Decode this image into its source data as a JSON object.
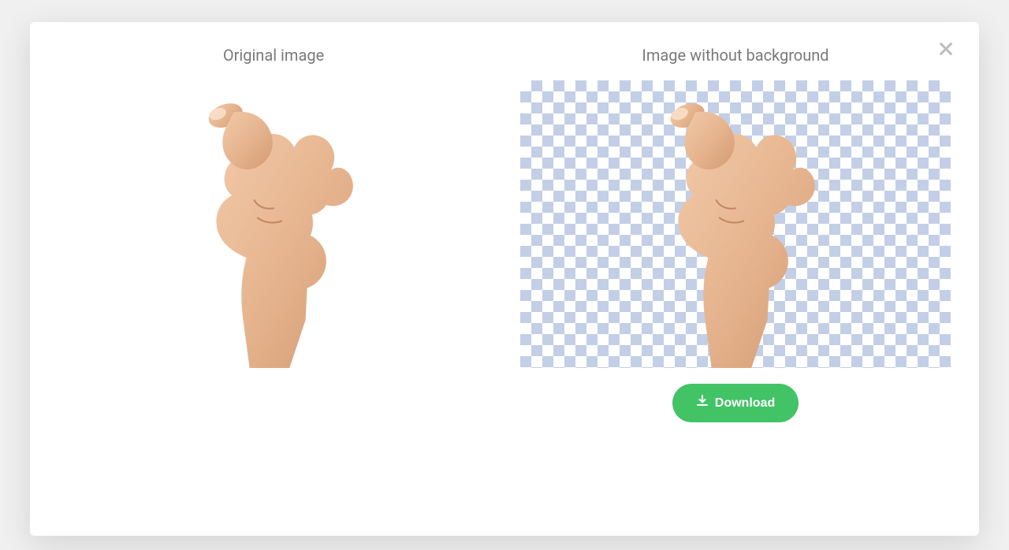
{
  "modal": {
    "close_label": "Close"
  },
  "left": {
    "title": "Original image"
  },
  "right": {
    "title": "Image without background",
    "download_label": "Download"
  }
}
